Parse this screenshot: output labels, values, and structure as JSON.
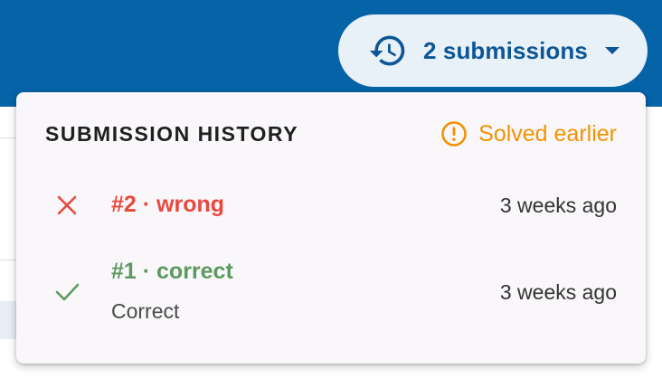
{
  "toggle": {
    "label": "2 submissions",
    "icon": "history-icon",
    "caret": "caret-down-icon"
  },
  "panel": {
    "title": "SUBMISSION HISTORY",
    "status": {
      "text": "Solved earlier",
      "icon": "alert-circle-icon",
      "color": "#f19200"
    },
    "submissions": [
      {
        "title": "#2 · wrong",
        "subtitle": "",
        "time": "3 weeks ago",
        "result": "wrong",
        "icon": "close-icon",
        "color": "#e8483e"
      },
      {
        "title": "#1 · correct",
        "subtitle": "Correct",
        "time": "3 weeks ago",
        "result": "correct",
        "icon": "check-icon",
        "color": "#5b9a5f"
      }
    ]
  },
  "colors": {
    "header": "#0563a8",
    "toggle_bg": "#e9f1f8",
    "toggle_text": "#0c5596",
    "panel_bg": "#faf7fb"
  }
}
